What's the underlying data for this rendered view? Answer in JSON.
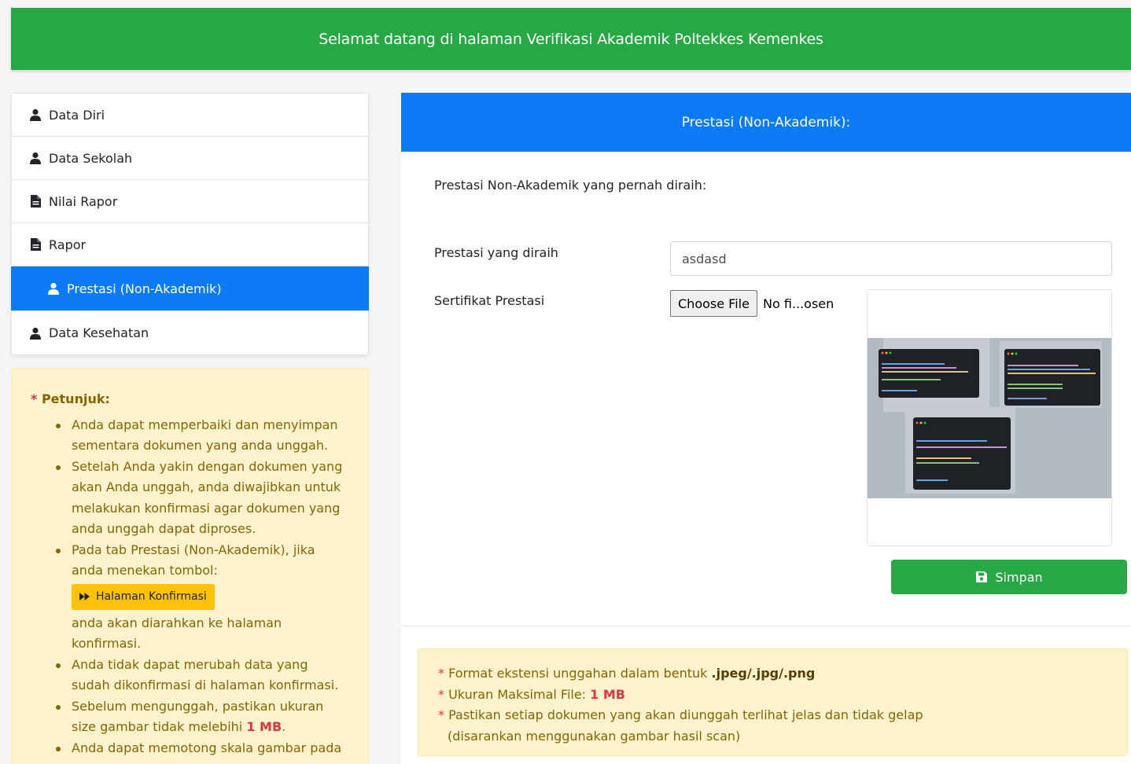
{
  "banner": {
    "text": "Selamat datang di halaman Verifikasi Akademik Poltekkes Kemenkes"
  },
  "sidebar": {
    "items": [
      {
        "label": "Data Diri",
        "icon": "user-icon"
      },
      {
        "label": "Data Sekolah",
        "icon": "user-icon"
      },
      {
        "label": "Nilai Rapor",
        "icon": "file-icon"
      },
      {
        "label": "Rapor",
        "icon": "file-icon"
      },
      {
        "label": "Prestasi (Non-Akademik)",
        "icon": "user-icon",
        "active": true
      },
      {
        "label": "Data Kesehatan",
        "icon": "user-icon"
      }
    ]
  },
  "instructions": {
    "star": "*",
    "title": "Petunjuk:",
    "items": [
      "Anda dapat memperbaiki dan menyimpan sementara dokumen yang anda unggah.",
      "Setelah Anda yakin dengan dokumen yang akan Anda unggah, anda diwajibkan untuk melakukan konfirmasi agar dokumen yang anda unggah dapat diproses.",
      "Pada tab Prestasi (Non-Akademik), jika anda menekan tombol:",
      "Anda tidak dapat merubah data yang sudah dikonfirmasi di halaman konfirmasi.",
      "Sebelum mengunggah, pastikan ukuran size gambar tidak melebihi",
      "Anda dapat memotong skala gambar pada"
    ],
    "confirm_button": "Halaman Konfirmasi",
    "redirect_text": "anda akan diarahkan ke halaman konfirmasi.",
    "size_limit": "1 MB",
    "size_suffix": "."
  },
  "card": {
    "header": "Prestasi (Non-Akademik):",
    "intro": "Prestasi Non-Akademik yang pernah diraih:",
    "achievement_label": "Prestasi yang diraih",
    "achievement_value": "asdasd",
    "certificate_label": "Sertifikat Prestasi",
    "choose_file": "Choose File",
    "file_status": "No fi...osen",
    "save_button": "Simpan"
  },
  "info": {
    "star": "*",
    "format_text": "Format ekstensi unggahan dalam bentuk",
    "format_value": ".jpeg/.jpg/.png",
    "size_text": "Ukuran Maksimal File:",
    "size_value": "1 MB",
    "clarity_text": "Pastikan setiap dokumen yang akan diunggah terlihat jelas dan tidak gelap",
    "clarity_note": "(disarankan menggunakan gambar hasil scan)"
  },
  "colors": {
    "banner": "#28a745",
    "primary": "#0d7bf7",
    "warning_bg": "#fff3cd",
    "warning_text": "#856404",
    "danger": "#dc3545",
    "confirm_btn": "#ffc107"
  }
}
